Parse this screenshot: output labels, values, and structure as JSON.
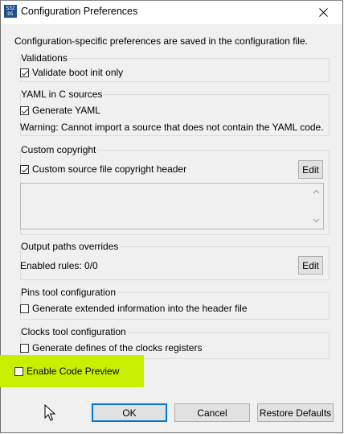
{
  "window": {
    "title": "Configuration Preferences",
    "icon_text": "S32 DS"
  },
  "intro": "Configuration-specific preferences are saved in the configuration file.",
  "validations": {
    "label": "Validations",
    "checkbox_label": "Validate boot init only",
    "checked": true
  },
  "yaml": {
    "label": "YAML in C sources",
    "checkbox_label": "Generate YAML",
    "checked": true,
    "warning": "Warning: Cannot import a source that does not contain the YAML code."
  },
  "copyright": {
    "label": "Custom copyright",
    "checkbox_label": "Custom source file copyright header",
    "checked": true,
    "edit_label": "Edit"
  },
  "output_paths": {
    "label": "Output paths overrides",
    "rules_text": "Enabled rules: 0/0",
    "edit_label": "Edit"
  },
  "pins": {
    "label": "Pins tool configuration",
    "checkbox_label": "Generate extended information into the header file",
    "checked": false
  },
  "clocks": {
    "label": "Clocks tool configuration",
    "checkbox_label": "Generate defines of the clocks registers",
    "checked": false
  },
  "code_preview": {
    "checkbox_label": "Enable Code Preview",
    "checked": false,
    "highlight_color": "#c8ef00"
  },
  "buttons": {
    "ok": "OK",
    "cancel": "Cancel",
    "restore": "Restore Defaults"
  },
  "colors": {
    "dialog_bg": "#f0f0f0",
    "accent": "#0078d7"
  }
}
